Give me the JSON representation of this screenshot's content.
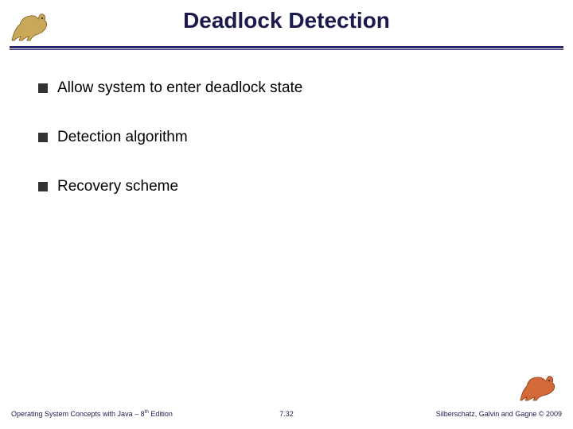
{
  "slide": {
    "title": "Deadlock Detection",
    "bullets": [
      "Allow system to enter deadlock state",
      "Detection algorithm",
      "Recovery scheme"
    ]
  },
  "footer": {
    "left_prefix": "Operating System Concepts with Java – 8",
    "left_suffix": " Edition",
    "left_super": "th",
    "center": "7.32",
    "right": "Silberschatz, Galvin and Gagne © 2009"
  },
  "icons": {
    "dino_left": "dinosaur-icon",
    "dino_right": "dinosaur-icon"
  }
}
